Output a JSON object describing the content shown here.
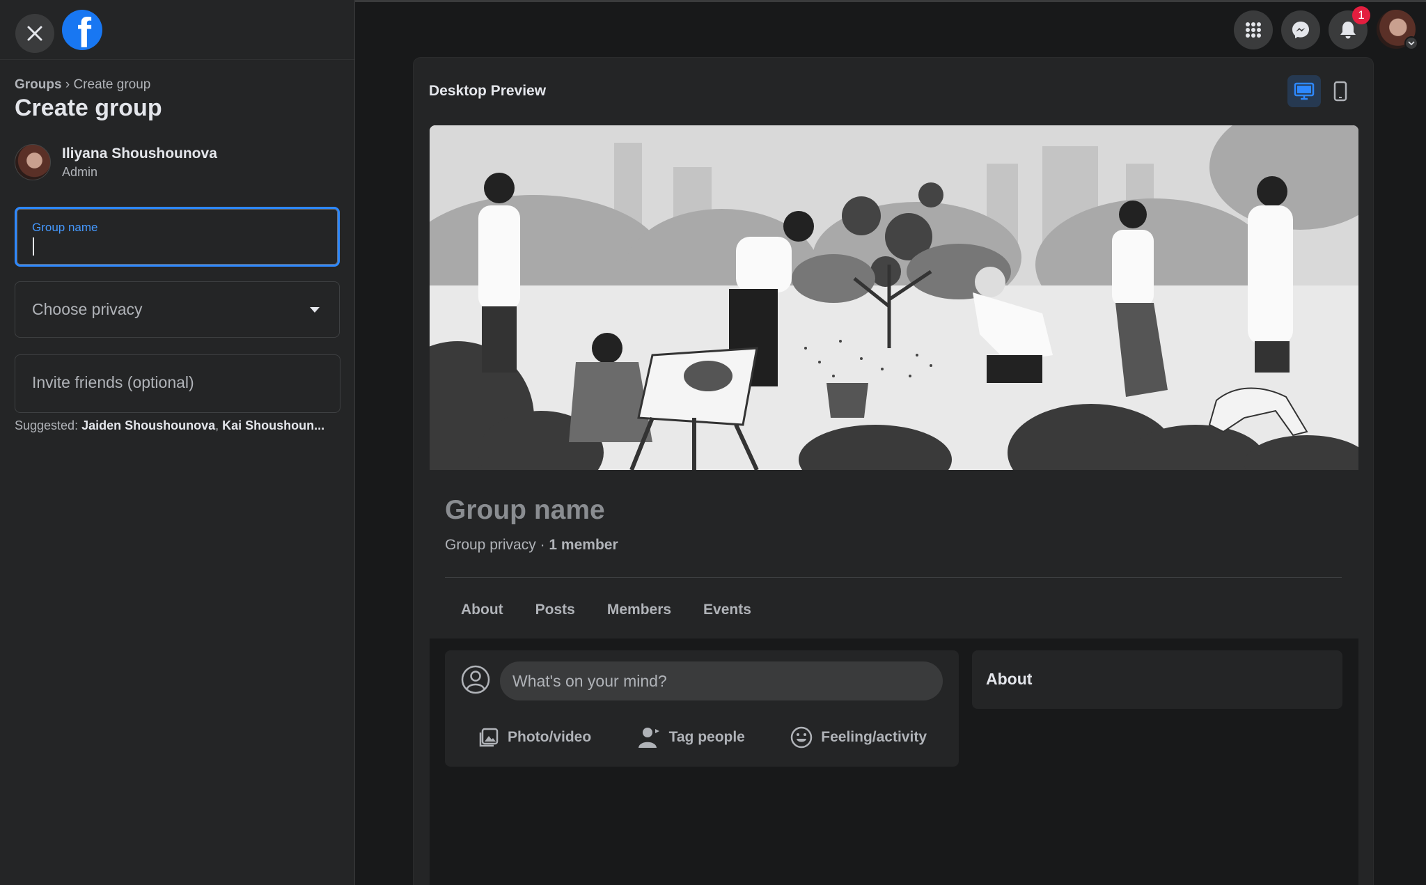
{
  "sidebar": {
    "breadcrumb": {
      "parent": "Groups",
      "separator": "›",
      "current": "Create group"
    },
    "title": "Create group",
    "admin": {
      "name": "Iliyana Shoushounova",
      "role": "Admin"
    },
    "group_name_label": "Group name",
    "group_name_value": "",
    "privacy_placeholder": "Choose privacy",
    "invite_placeholder": "Invite friends (optional)",
    "suggested_label": "Suggested:",
    "suggested_people": [
      "Jaiden Shoushounova",
      "Kai Shoushoun..."
    ]
  },
  "topbar": {
    "icons": [
      "menu-grid-icon",
      "messenger-icon",
      "bell-icon"
    ],
    "notification_count": "1"
  },
  "preview": {
    "title": "Desktop Preview",
    "group_name": "Group name",
    "privacy": "Group privacy",
    "meta_separator": "·",
    "members": "1 member",
    "tabs": [
      "About",
      "Posts",
      "Members",
      "Events"
    ],
    "composer_placeholder": "What's on your mind?",
    "actions": [
      "Photo/video",
      "Tag people",
      "Feeling/activity"
    ],
    "about_title": "About"
  },
  "colors": {
    "accent": "#2d88ff",
    "brand": "#1877f2",
    "badge": "#e41e3f"
  }
}
